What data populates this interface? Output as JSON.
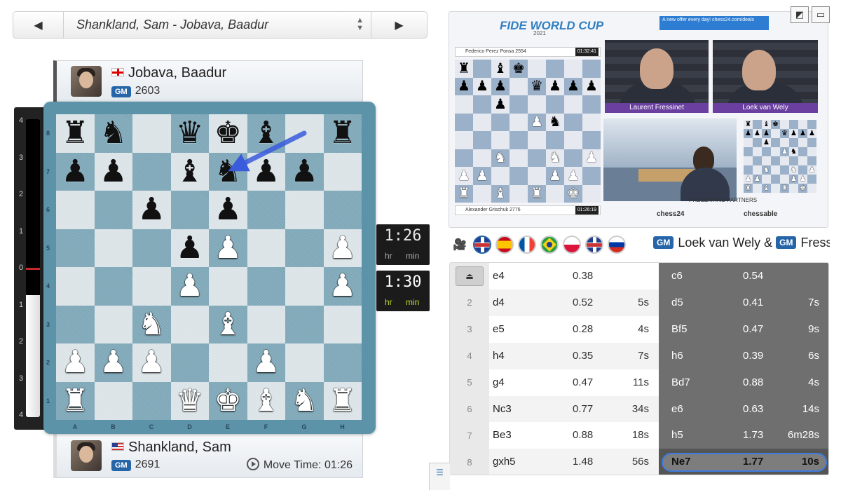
{
  "nav": {
    "prev_icon": "◀",
    "next_icon": "▶",
    "game_title": "Shankland, Sam - Jobava, Baadur",
    "sort_icon": "▲▼"
  },
  "players": {
    "top": {
      "name": "Jobava, Baadur",
      "title": "GM",
      "rating": "2603",
      "flag": "georgia-flag"
    },
    "bottom": {
      "name": "Shankland, Sam",
      "title": "GM",
      "rating": "2691",
      "flag": "usa-flag",
      "move_time_label": "Move Time:",
      "move_time": "01:26"
    }
  },
  "eval": {
    "labels": [
      "4",
      "3",
      "2",
      "1",
      "0",
      "1",
      "2",
      "3",
      "4"
    ],
    "white_share": 0.41
  },
  "board": {
    "files": [
      "A",
      "B",
      "C",
      "D",
      "E",
      "F",
      "G",
      "H"
    ],
    "ranks": [
      "8",
      "7",
      "6",
      "5",
      "4",
      "3",
      "2",
      "1"
    ],
    "position": [
      [
        "r",
        "n",
        "",
        "q",
        "k",
        "b",
        "",
        "r"
      ],
      [
        "p",
        "p",
        "",
        "b",
        "n",
        "p",
        "p",
        ""
      ],
      [
        "",
        "",
        "p",
        "",
        "p",
        "",
        "",
        ""
      ],
      [
        "",
        "",
        "",
        "p",
        "P",
        "",
        "",
        "P"
      ],
      [
        "",
        "",
        "",
        "P",
        "",
        "",
        "",
        "P"
      ],
      [
        "",
        "",
        "N",
        "",
        "B",
        "",
        "",
        ""
      ],
      [
        "P",
        "P",
        "P",
        "",
        "",
        "P",
        "",
        ""
      ],
      [
        "R",
        "",
        "",
        "Q",
        "K",
        "B",
        "N",
        "R"
      ]
    ],
    "last_move": {
      "from": "g8",
      "to": "e7"
    }
  },
  "clocks": {
    "top": {
      "time": "1:26",
      "hr": "hr",
      "min": "min"
    },
    "bottom": {
      "time": "1:30",
      "hr": "hr",
      "min": "min"
    }
  },
  "video": {
    "event_logo": "FIDE WORLD CUP",
    "event_year": "2021",
    "ad_text": "A new offer every day! chess24.com/deals",
    "top_player": "Federico Perez Ponsa 2554",
    "top_clock": "01:32:41",
    "bottom_player": "Alexander Grischuk 2776",
    "bottom_clock": "01:26:19",
    "cam1_name": "Laurent Fressinet",
    "cam2_name": "Loek van Wely",
    "partners_label": "PRESENTING PARTNERS",
    "sponsor1": "chess24",
    "sponsor2": "chessable",
    "mini_position": [
      [
        "r",
        "",
        "b",
        "k",
        "",
        "",
        "",
        ""
      ],
      [
        "p",
        "p",
        "p",
        "",
        "q",
        "p",
        "p",
        "p"
      ],
      [
        "",
        "",
        "p",
        "",
        "",
        "",
        "",
        ""
      ],
      [
        "",
        "",
        "",
        "",
        "P",
        "n",
        "",
        ""
      ],
      [
        "",
        "",
        "",
        "",
        "",
        "",
        "",
        ""
      ],
      [
        "",
        "",
        "N",
        "",
        "",
        "N",
        "",
        "P"
      ],
      [
        "P",
        "P",
        "",
        "",
        "",
        "P",
        "P",
        ""
      ],
      [
        "R",
        "",
        "B",
        "",
        "R",
        "",
        "K",
        ""
      ]
    ],
    "corner_icons": [
      "expand-icon",
      "fullscreen-icon"
    ]
  },
  "languages": [
    {
      "code": "en",
      "selected": true
    },
    {
      "code": "es",
      "selected": false
    },
    {
      "code": "fr",
      "selected": false
    },
    {
      "code": "br",
      "selected": false
    },
    {
      "code": "pl",
      "selected": false
    },
    {
      "code": "en",
      "selected": false
    },
    {
      "code": "ru",
      "selected": false
    }
  ],
  "commentary": {
    "gm1_title": "GM",
    "gm1_name": "Loek van Wely &",
    "gm2_title": "GM",
    "gm2_name": "Fress"
  },
  "moves": [
    {
      "num": "",
      "white": "e4",
      "white_eval": "0.38",
      "white_time": "",
      "black": "c6",
      "black_eval": "0.54",
      "black_time": ""
    },
    {
      "num": "2",
      "white": "d4",
      "white_eval": "0.52",
      "white_time": "5s",
      "black": "d5",
      "black_eval": "0.41",
      "black_time": "7s"
    },
    {
      "num": "3",
      "white": "e5",
      "white_eval": "0.28",
      "white_time": "4s",
      "black": "Bf5",
      "black_eval": "0.47",
      "black_time": "9s"
    },
    {
      "num": "4",
      "white": "h4",
      "white_eval": "0.35",
      "white_time": "7s",
      "black": "h6",
      "black_eval": "0.39",
      "black_time": "6s"
    },
    {
      "num": "5",
      "white": "g4",
      "white_eval": "0.47",
      "white_time": "11s",
      "black": "Bd7",
      "black_eval": "0.88",
      "black_time": "4s"
    },
    {
      "num": "6",
      "white": "Nc3",
      "white_eval": "0.77",
      "white_time": "34s",
      "black": "e6",
      "black_eval": "0.63",
      "black_time": "14s"
    },
    {
      "num": "7",
      "white": "Be3",
      "white_eval": "0.88",
      "white_time": "18s",
      "black": "h5",
      "black_eval": "1.73",
      "black_time": "6m28s"
    },
    {
      "num": "8",
      "white": "gxh5",
      "white_eval": "1.48",
      "white_time": "56s",
      "black": "Ne7",
      "black_eval": "1.77",
      "black_time": "10s"
    }
  ],
  "current_move_index": 7,
  "colors": {
    "accent": "#2565a8",
    "board_frame": "#5c93a8",
    "highlight": "#3d7be0",
    "last_move_arrow": "#3a5bdc"
  }
}
